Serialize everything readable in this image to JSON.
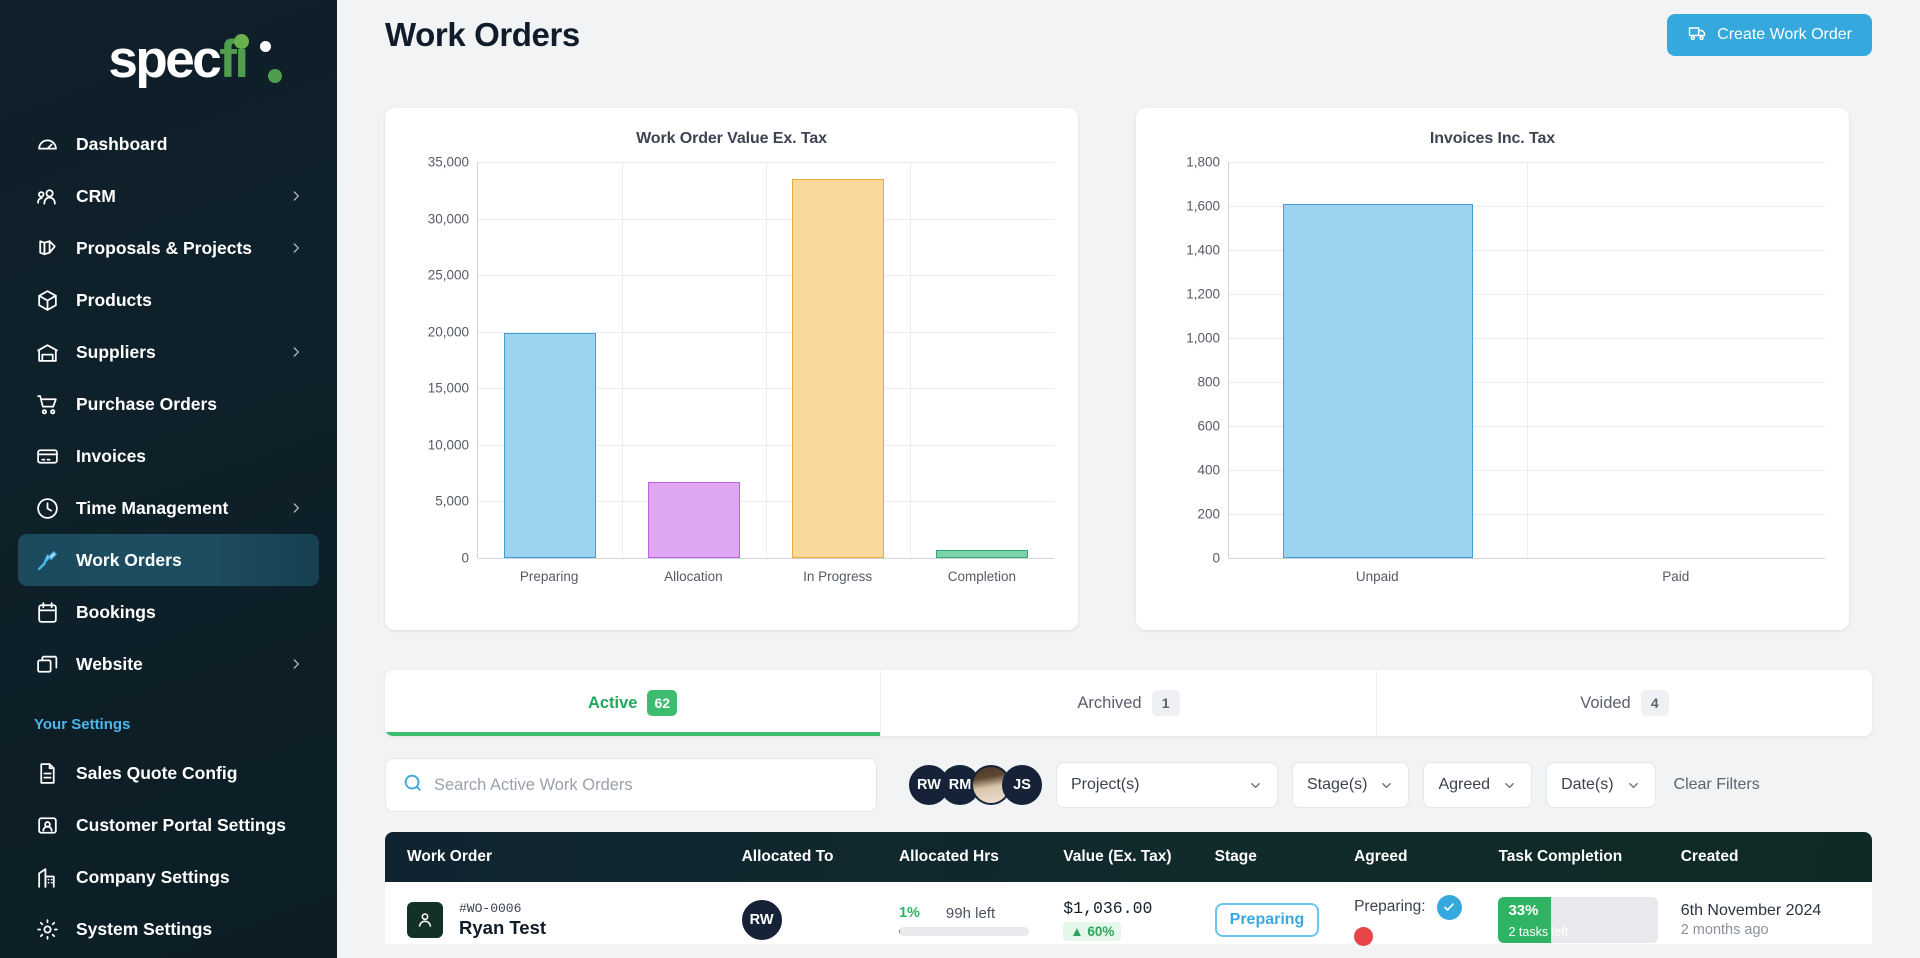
{
  "brand": {
    "name_white": "spec",
    "name_green": "fi",
    "accent": "#35a9dd",
    "green": "#4e9e4e"
  },
  "sidebar": {
    "items": [
      {
        "label": "Dashboard",
        "icon": "gauge-icon",
        "chevron": false,
        "active": false
      },
      {
        "label": "CRM",
        "icon": "people-icon",
        "chevron": true,
        "active": false
      },
      {
        "label": "Proposals & Projects",
        "icon": "layers-icon",
        "chevron": true,
        "active": false
      },
      {
        "label": "Products",
        "icon": "box-icon",
        "chevron": false,
        "active": false
      },
      {
        "label": "Suppliers",
        "icon": "warehouse-icon",
        "chevron": true,
        "active": false
      },
      {
        "label": "Purchase Orders",
        "icon": "cart-icon",
        "chevron": false,
        "active": false
      },
      {
        "label": "Invoices",
        "icon": "card-icon",
        "chevron": false,
        "active": false
      },
      {
        "label": "Time Management",
        "icon": "clock-icon",
        "chevron": true,
        "active": false
      },
      {
        "label": "Work Orders",
        "icon": "screwdriver-icon",
        "chevron": false,
        "active": true
      },
      {
        "label": "Bookings",
        "icon": "calendar-icon",
        "chevron": false,
        "active": false
      },
      {
        "label": "Website",
        "icon": "windows-icon",
        "chevron": true,
        "active": false
      }
    ],
    "section_title": "Your Settings",
    "settings_items": [
      {
        "label": "Sales Quote Config",
        "icon": "document-icon"
      },
      {
        "label": "Customer Portal Settings",
        "icon": "user-card-icon"
      },
      {
        "label": "Company Settings",
        "icon": "building-icon"
      },
      {
        "label": "System Settings",
        "icon": "gear-icon"
      }
    ]
  },
  "header": {
    "title": "Work Orders",
    "create_button": "Create Work Order"
  },
  "chart_data": [
    {
      "type": "bar",
      "title": "Work Order Value Ex. Tax",
      "categories": [
        "Preparing",
        "Allocation",
        "In Progress",
        "Completion"
      ],
      "values": [
        19900,
        6700,
        33500,
        700
      ],
      "colors": [
        "#9dd2f0",
        "#dfa7f2",
        "#fbd99a",
        "#7fd3a8"
      ],
      "border_colors": [
        "#3fa0d8",
        "#c060e8",
        "#f0a73c",
        "#32a874"
      ],
      "ylim": [
        0,
        35000
      ],
      "yticks": [
        0,
        5000,
        10000,
        15000,
        20000,
        25000,
        30000,
        35000
      ],
      "ytick_labels": [
        "0",
        "5,000",
        "10,000",
        "15,000",
        "20,000",
        "25,000",
        "30,000",
        "35,000"
      ],
      "xlabel": "",
      "ylabel": "",
      "grid": true,
      "legend": "none"
    },
    {
      "type": "bar",
      "title": "Invoices Inc. Tax",
      "categories": [
        "Unpaid",
        "Paid"
      ],
      "values": [
        1610,
        0
      ],
      "colors": [
        "#9dd2f0",
        "#9dd2f0"
      ],
      "border_colors": [
        "#3fa0d8",
        "#3fa0d8"
      ],
      "ylim": [
        0,
        1800
      ],
      "yticks": [
        0,
        200,
        400,
        600,
        800,
        1000,
        1200,
        1400,
        1600,
        1800
      ],
      "ytick_labels": [
        "0",
        "200",
        "400",
        "600",
        "800",
        "1,000",
        "1,200",
        "1,400",
        "1,600",
        "1,800"
      ],
      "xlabel": "",
      "ylabel": "",
      "grid": true,
      "legend": "none"
    }
  ],
  "tabs": [
    {
      "label": "Active",
      "count": "62",
      "active": true
    },
    {
      "label": "Archived",
      "count": "1",
      "active": false
    },
    {
      "label": "Voided",
      "count": "4",
      "active": false
    }
  ],
  "filters": {
    "search_placeholder": "Search Active Work Orders",
    "search_value": "",
    "avatars": [
      {
        "initials": "RW",
        "type": "initials"
      },
      {
        "initials": "RM",
        "type": "initials"
      },
      {
        "initials": "",
        "type": "photo"
      },
      {
        "initials": "JS",
        "type": "initials"
      }
    ],
    "selects": [
      {
        "label": "Project(s)",
        "wide": true
      },
      {
        "label": "Stage(s)",
        "wide": false
      },
      {
        "label": "Agreed",
        "wide": false
      },
      {
        "label": "Date(s)",
        "wide": false
      }
    ],
    "clear_label": "Clear Filters"
  },
  "table": {
    "columns": [
      "Work Order",
      "Allocated To",
      "Allocated Hrs",
      "Value (Ex. Tax)",
      "Stage",
      "Agreed",
      "Task Completion",
      "Created"
    ],
    "rows": [
      {
        "wo_id": "#WO-0006",
        "wo_name": "Ryan Test",
        "allocated_to": "RW",
        "hrs_pct": "1%",
        "hrs_pct_num": 1,
        "hrs_left": "99h left",
        "value": "$1,036.00",
        "value_chip": "▲ 60%",
        "stage": "Preparing",
        "agreed_label": "Preparing:",
        "task_pct": "33%",
        "task_pct_num": 33,
        "task_sub": "2 tasks left",
        "created_date": "6th November 2024",
        "created_ago": "2 months ago"
      }
    ]
  }
}
